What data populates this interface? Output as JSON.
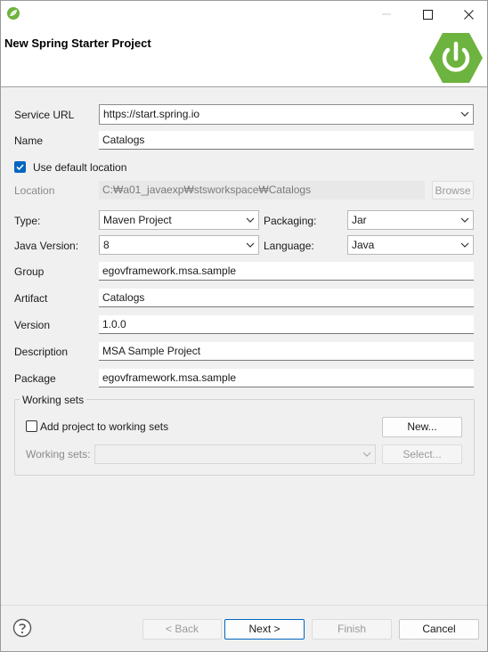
{
  "window": {
    "title": "New Spring Starter Project",
    "icon": "spring-leaf-icon",
    "controls": [
      "minimize-icon",
      "maximize-icon",
      "close-icon"
    ]
  },
  "header": {
    "title": "New Spring Starter Project",
    "logo": "spring-power-logo",
    "logo_color": "#6db33f"
  },
  "form": {
    "service_url": {
      "label": "Service URL",
      "value": "https://start.spring.io"
    },
    "name": {
      "label": "Name",
      "value": "Catalogs"
    },
    "use_default_location": {
      "label": "Use default location",
      "checked": true
    },
    "location": {
      "label": "Location",
      "value": "C:₩a01_javaexp₩stsworkspace₩Catalogs",
      "browse_label": "Browse"
    },
    "type": {
      "label": "Type:",
      "value": "Maven Project"
    },
    "packaging": {
      "label": "Packaging:",
      "value": "Jar"
    },
    "java_version": {
      "label": "Java Version:",
      "value": "8"
    },
    "language": {
      "label": "Language:",
      "value": "Java"
    },
    "group": {
      "label": "Group",
      "value": "egovframework.msa.sample"
    },
    "artifact": {
      "label": "Artifact",
      "value": "Catalogs"
    },
    "version": {
      "label": "Version",
      "value": "1.0.0"
    },
    "description": {
      "label": "Description",
      "value": "MSA Sample Project"
    },
    "package": {
      "label": "Package",
      "value": "egovframework.msa.sample"
    }
  },
  "working_sets": {
    "title": "Working sets",
    "add_label": "Add project to working sets",
    "add_checked": false,
    "new_button": "New...",
    "sets_label": "Working sets:",
    "sets_value": "",
    "select_button": "Select..."
  },
  "footer": {
    "help_icon": "help-icon",
    "back": "< Back",
    "next": "Next >",
    "finish": "Finish",
    "cancel": "Cancel"
  },
  "colors": {
    "accent": "#0067c0",
    "spring_green": "#6db33f"
  }
}
